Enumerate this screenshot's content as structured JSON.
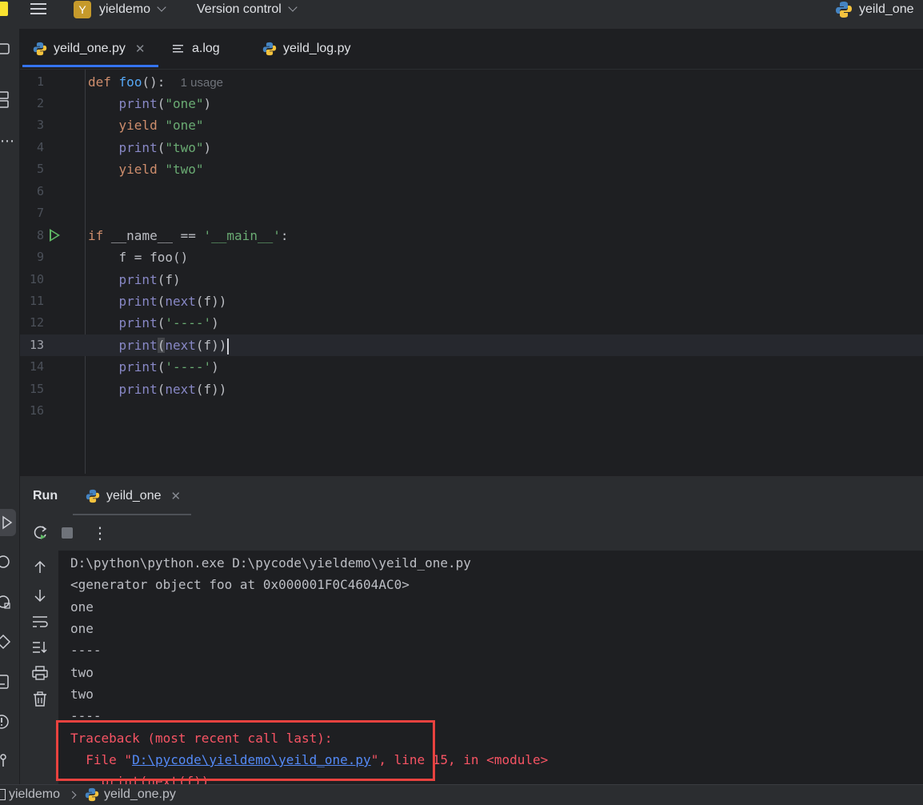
{
  "titlebar": {
    "project_badge": "Y",
    "project_name": "yieldemo",
    "vcs_label": "Version control",
    "run_config": "yeild_one"
  },
  "tabs": [
    {
      "label": "yeild_one.py",
      "icon": "python-icon",
      "active": true
    },
    {
      "label": "a.log",
      "icon": "text-file-icon",
      "active": false
    },
    {
      "label": "yeild_log.py",
      "icon": "python-icon",
      "active": false
    }
  ],
  "tab_close_glyph": "✕",
  "editor": {
    "usage_hint": "1 usage",
    "line_numbers": [
      "1",
      "2",
      "3",
      "4",
      "5",
      "6",
      "7",
      "8",
      "9",
      "10",
      "11",
      "12",
      "13",
      "14",
      "15",
      "16"
    ],
    "current_line": 13,
    "code": {
      "l1_kw": "def",
      "l1_fn": "foo",
      "l1_rest": "():",
      "l2_fn": "print",
      "l2_open": "(",
      "l2_str": "\"one\"",
      "l2_close": ")",
      "l3_kw": "yield",
      "l3_str": "\"one\"",
      "l4_fn": "print",
      "l4_open": "(",
      "l4_str": "\"two\"",
      "l4_close": ")",
      "l5_kw": "yield",
      "l5_str": "\"two\"",
      "l8_kw": "if",
      "l8_mid": "__name__ ==",
      "l8_str": "'__main__'",
      "l8_end": ":",
      "l9": "f = foo()",
      "l10_fn": "print",
      "l10_rest": "(f)",
      "l11_fn": "print",
      "l11_open": "(",
      "l11_fn2": "next",
      "l11_rest": "(f))",
      "l12_fn": "print",
      "l12_open": "(",
      "l12_str": "'----'",
      "l12_close": ")",
      "l13_fn": "print",
      "l13_open": "(",
      "l13_fn2": "next",
      "l13_rest": "(f))",
      "l14_fn": "print",
      "l14_open": "(",
      "l14_str": "'----'",
      "l14_close": ")",
      "l15_fn": "print",
      "l15_open": "(",
      "l15_fn2": "next",
      "l15_rest": "(f))"
    }
  },
  "run_panel": {
    "title": "Run",
    "tab_label": "yeild_one",
    "more_glyph": "⋮"
  },
  "console": {
    "lines": [
      "D:\\python\\python.exe D:\\pycode\\yieldemo\\yeild_one.py",
      "<generator object foo at 0x000001F0C4604AC0>",
      "one",
      "one",
      "----",
      "two",
      "two",
      "----"
    ],
    "traceback_header": "Traceback (most recent call last):",
    "file_prefix": "  File \"",
    "file_link": "D:\\pycode\\yieldemo\\yeild_one.py",
    "file_suffix": "\", line 15, in <module>",
    "partial_line": "    print(next(f))"
  },
  "statusbar": {
    "crumb_project": "yieldemo",
    "crumb_file": "yeild_one.py"
  },
  "colors": {
    "background": "#1e1f22",
    "panel": "#2b2d30",
    "keyword": "#cf8e6d",
    "function": "#56a8f5",
    "string": "#6aab73",
    "error": "#f75464",
    "highlight_box": "#e8423f"
  }
}
